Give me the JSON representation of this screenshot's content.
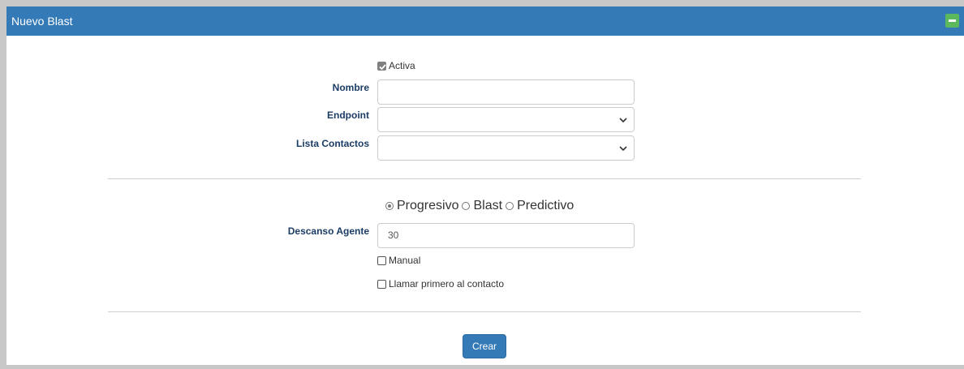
{
  "panel": {
    "title": "Nuevo Blast"
  },
  "form": {
    "activa": {
      "label": "Activa",
      "checked": true
    },
    "nombre": {
      "label": "Nombre",
      "value": ""
    },
    "endpoint": {
      "label": "Endpoint",
      "value": ""
    },
    "lista_contactos": {
      "label": "Lista Contactos",
      "value": ""
    },
    "modes": [
      {
        "label": "Progresivo",
        "selected": true
      },
      {
        "label": "Blast",
        "selected": false
      },
      {
        "label": "Predictivo",
        "selected": false
      }
    ],
    "descanso_agente": {
      "label": "Descanso Agente",
      "value": "30"
    },
    "manual": {
      "label": "Manual",
      "checked": false
    },
    "llamar_primero": {
      "label": "Llamar primero al contacto",
      "checked": false
    },
    "submit_label": "Crear"
  },
  "colors": {
    "header": "#337ab7",
    "collapse": "#5cb85c",
    "label": "#1b3c64"
  },
  "icons": {
    "collapse": "minus-icon",
    "select": "chevron-down-icon"
  }
}
